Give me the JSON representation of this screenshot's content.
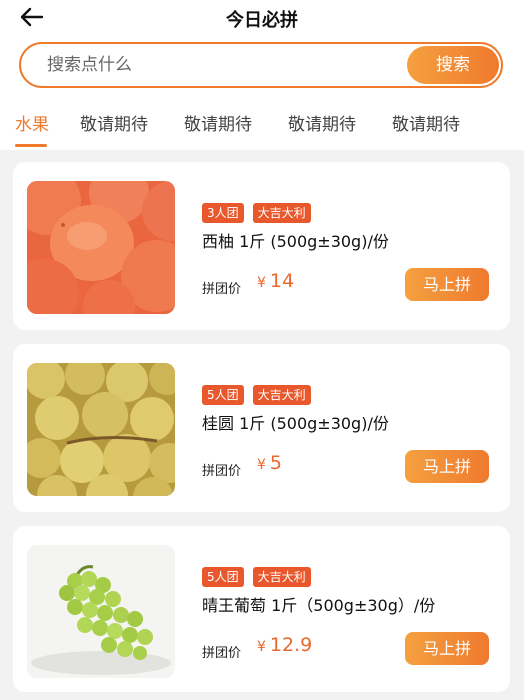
{
  "header": {
    "title": "今日必拼"
  },
  "search": {
    "placeholder": "搜索点什么",
    "button_label": "搜索"
  },
  "tabs": [
    {
      "label": "水果",
      "active": true
    },
    {
      "label": "敬请期待",
      "active": false
    },
    {
      "label": "敬请期待",
      "active": false
    },
    {
      "label": "敬请期待",
      "active": false
    },
    {
      "label": "敬请期待",
      "active": false
    }
  ],
  "products": [
    {
      "badges": [
        "3人团",
        "大吉大利"
      ],
      "name": "西柚 1斤 (500g±30g)/份",
      "price_label": "拼团价",
      "currency": "¥",
      "price": "14",
      "button_label": "马上拼",
      "image": "grapefruit"
    },
    {
      "badges": [
        "5人团",
        "大吉大利"
      ],
      "name": "桂圆 1斤 (500g±30g)/份",
      "price_label": "拼团价",
      "currency": "¥",
      "price": "5",
      "button_label": "马上拼",
      "image": "longan"
    },
    {
      "badges": [
        "5人团",
        "大吉大利"
      ],
      "name": "晴王葡萄 1斤（500g±30g）/份",
      "price_label": "拼团价",
      "currency": "¥",
      "price": "12.9",
      "button_label": "马上拼",
      "image": "grapes"
    }
  ],
  "colors": {
    "accent": "#f07a2c",
    "badge": "#e9582c",
    "price": "#e9682c"
  }
}
